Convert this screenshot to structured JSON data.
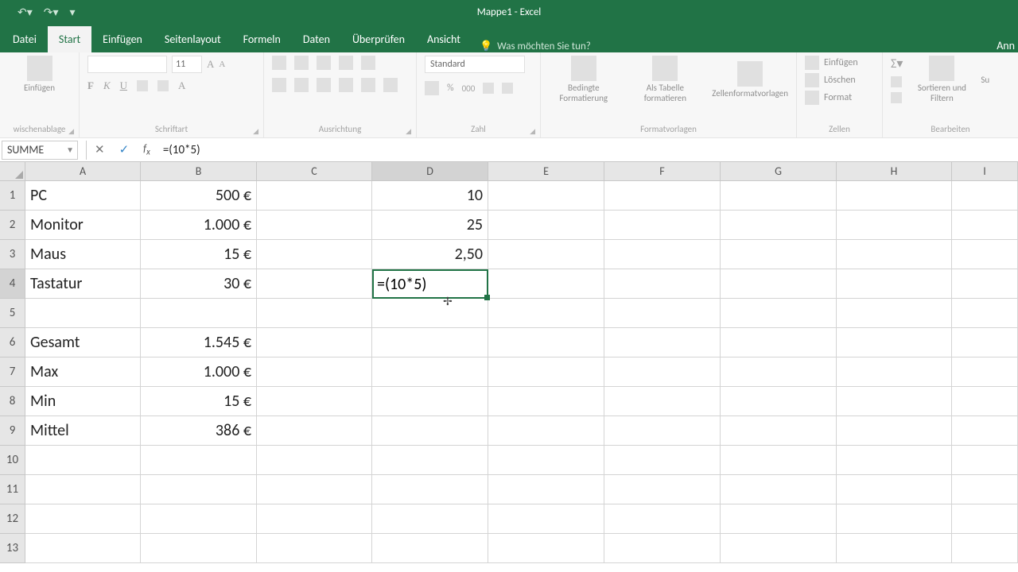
{
  "title": "Mappe1 - Excel",
  "tabs": [
    "Datei",
    "Start",
    "Einfügen",
    "Seitenlayout",
    "Formeln",
    "Daten",
    "Überprüfen",
    "Ansicht"
  ],
  "active_tab": 1,
  "tellme_placeholder": "Was möchten Sie tun?",
  "right_cut": "Ann",
  "ribbon": {
    "groups": [
      "wischenablage",
      "Schriftart",
      "Ausrichtung",
      "Zahl",
      "Formatvorlagen",
      "Zellen",
      "Bearbeiten"
    ],
    "paste": "Einfügen",
    "font_size": "11",
    "number_format": "Standard",
    "cond_fmt": "Bedingte Formatierung",
    "as_table": "Als Tabelle formatieren",
    "cell_styles": "Zellenformatvorlagen",
    "insert": "Einfügen",
    "delete": "Löschen",
    "format": "Format",
    "sort_filter": "Sortieren und Filtern",
    "find": "Su"
  },
  "formula_bar": {
    "name_box": "SUMME",
    "formula": "=(10*5)"
  },
  "columns": [
    "A",
    "B",
    "C",
    "D",
    "E",
    "F",
    "G",
    "H",
    "I"
  ],
  "active_col_index": 3,
  "active_row": 4,
  "rows": [
    1,
    2,
    3,
    4,
    5,
    6,
    7,
    8,
    9,
    10,
    11,
    12,
    13
  ],
  "cells": {
    "A1": "PC",
    "B1": "500 €",
    "D1": "10",
    "A2": "Monitor",
    "B2": "1.000 €",
    "D2": "25",
    "A3": "Maus",
    "B3": "15 €",
    "D3": "2,50",
    "A4": "Tastatur",
    "B4": "30 €",
    "D4": "=(10*5)",
    "A6": "Gesamt",
    "B6": "1.545 €",
    "A7": "Max",
    "B7": "1.000 €",
    "A8": "Min",
    "B8": "15 €",
    "A9": "Mittel",
    "B9": "386 €"
  },
  "editing_cell": "D4"
}
